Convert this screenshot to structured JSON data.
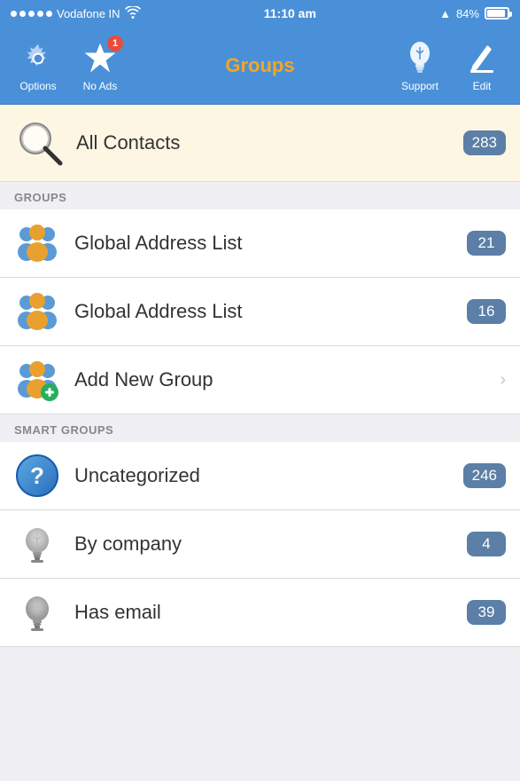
{
  "status_bar": {
    "carrier": "Vodafone IN",
    "wifi_symbol": "wifi",
    "time": "11:10 am",
    "arrow": "▲",
    "battery_percent": "84%"
  },
  "nav": {
    "title": "Groups",
    "options_label": "Options",
    "no_ads_label": "No Ads",
    "badge_count": "1",
    "support_label": "Support",
    "edit_label": "Edit"
  },
  "all_contacts": {
    "label": "All Contacts",
    "count": "283"
  },
  "groups_section": {
    "header": "GROUPS",
    "items": [
      {
        "label": "Global Address List",
        "count": "21",
        "has_count": true
      },
      {
        "label": "Global Address List",
        "count": "16",
        "has_count": true
      },
      {
        "label": "Add New Group",
        "count": "",
        "has_count": false
      }
    ]
  },
  "smart_groups_section": {
    "header": "SMART GROUPS",
    "items": [
      {
        "label": "Uncategorized",
        "count": "246",
        "icon_type": "question"
      },
      {
        "label": "By company",
        "count": "4",
        "icon_type": "bulb"
      },
      {
        "label": "Has email",
        "count": "39",
        "icon_type": "bulb_dim"
      }
    ]
  }
}
